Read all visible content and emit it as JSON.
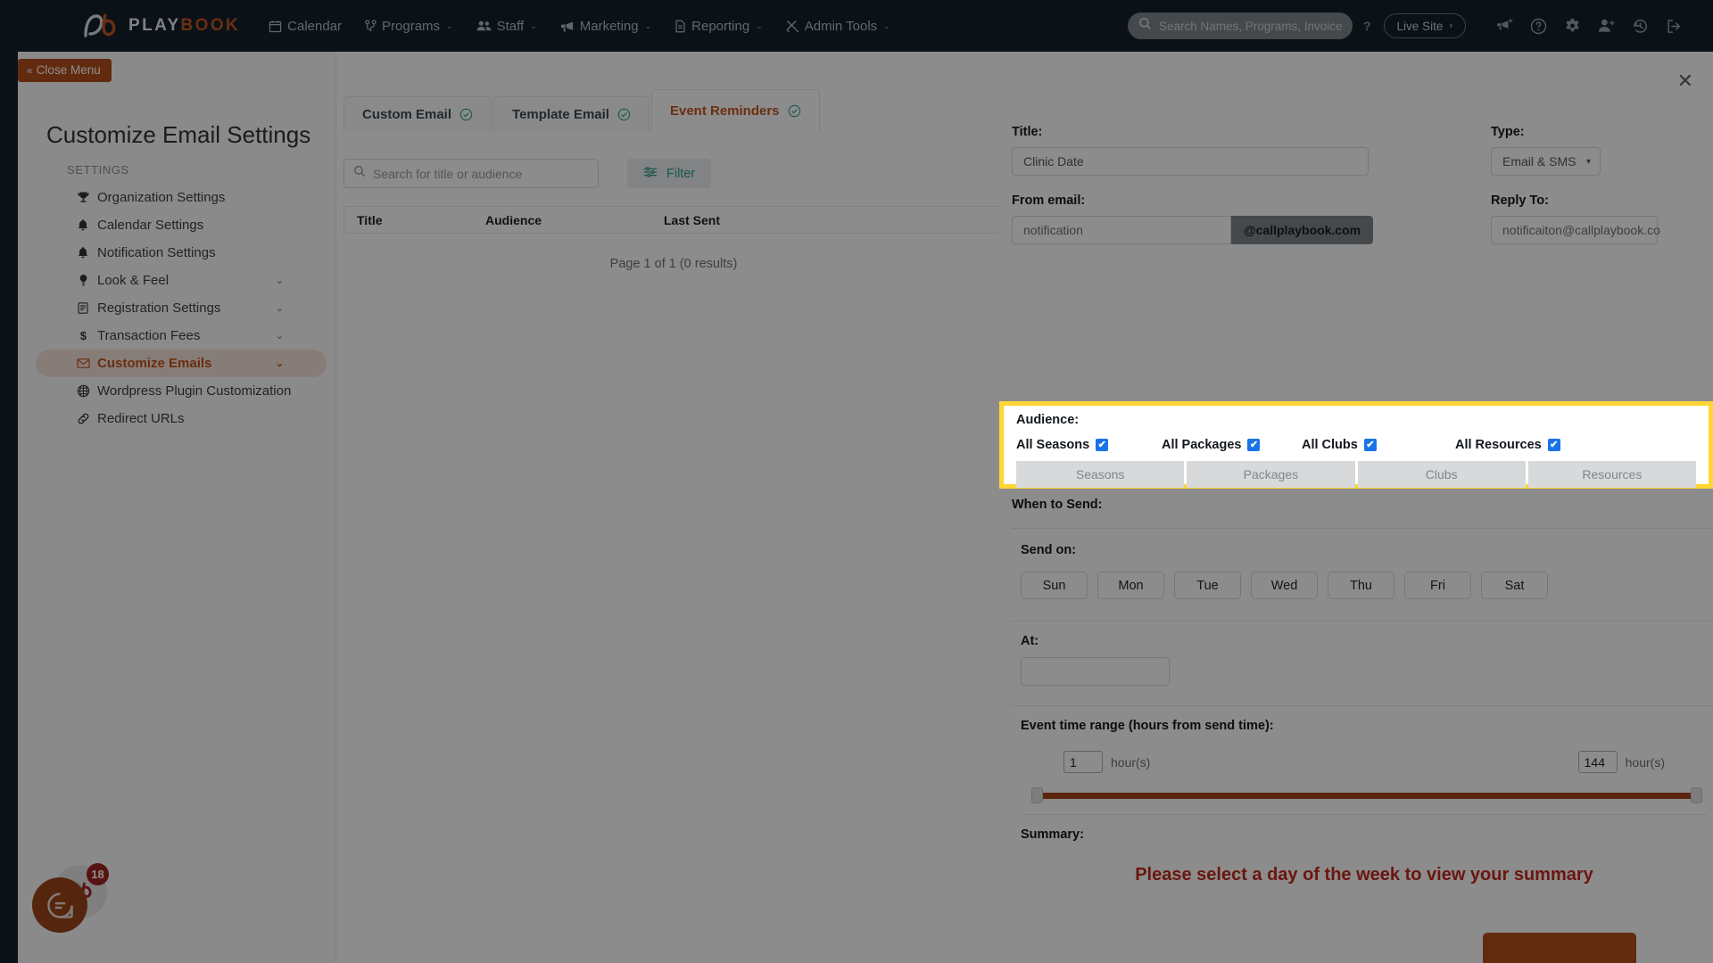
{
  "brand": {
    "name_left": "PLAY",
    "name_right": "BOOK",
    "accent": "#c4541f",
    "navbg": "#15212b"
  },
  "topnav": {
    "items": [
      {
        "label": "Calendar",
        "icon": "calendar-icon",
        "caret": false
      },
      {
        "label": "Programs",
        "icon": "sitemap-icon",
        "caret": true
      },
      {
        "label": "Staff",
        "icon": "users-icon",
        "caret": true
      },
      {
        "label": "Marketing",
        "icon": "megaphone-icon",
        "caret": true
      },
      {
        "label": "Reporting",
        "icon": "document-icon",
        "caret": true
      },
      {
        "label": "Admin Tools",
        "icon": "tools-icon",
        "caret": true
      }
    ],
    "search_placeholder": "Search Names, Programs, Invoice #...",
    "help_badge": "?",
    "live_site_label": "Live Site",
    "live_site_arrow": "›",
    "caret": "⌄",
    "right_icons": [
      "announcement-add-icon",
      "help-circle-icon",
      "gear-icon",
      "user-add-icon",
      "history-icon",
      "logout-icon"
    ]
  },
  "sidebar": {
    "close_menu_label": "Close Menu",
    "close_menu_chevron": "«",
    "title": "Customize Email Settings",
    "section_label": "SETTINGS",
    "items": [
      {
        "label": "Organization Settings",
        "icon": "trophy-icon",
        "chevron": false,
        "active": false
      },
      {
        "label": "Calendar Settings",
        "icon": "bell-icon",
        "chevron": false,
        "active": false
      },
      {
        "label": "Notification Settings",
        "icon": "bell-icon",
        "chevron": false,
        "active": false
      },
      {
        "label": "Look & Feel",
        "icon": "lightbulb-icon",
        "chevron": true,
        "active": false
      },
      {
        "label": "Registration Settings",
        "icon": "clipboard-icon",
        "chevron": true,
        "active": false
      },
      {
        "label": "Transaction Fees",
        "icon": "dollar-icon",
        "chevron": true,
        "active": false
      },
      {
        "label": "Customize Emails",
        "icon": "envelope-icon",
        "chevron": true,
        "active": true
      },
      {
        "label": "Wordpress Plugin Customization",
        "icon": "wordpress-icon",
        "chevron": false,
        "active": false
      },
      {
        "label": "Redirect URLs",
        "icon": "link-icon",
        "chevron": false,
        "active": false
      }
    ],
    "chevron_glyph": "⌄"
  },
  "tabs": [
    {
      "label": "Custom Email",
      "check": "✓",
      "active": false
    },
    {
      "label": "Template Email",
      "check": "✓",
      "active": false
    },
    {
      "label": "Event Reminders",
      "check": "✓",
      "active": true
    }
  ],
  "list_panel": {
    "search_placeholder": "Search for title or audience",
    "filter_label": "Filter",
    "columns": [
      "Title",
      "Audience",
      "Last Sent"
    ],
    "rows": [],
    "page_info": "Page 1 of 1 (0 results)"
  },
  "drawer": {
    "close_glyph": "✕",
    "title_label": "Title:",
    "title_value": "Clinic Date",
    "type_label": "Type:",
    "type_value": "Email & SMS",
    "from_email_label": "From email:",
    "from_email_value": "notification",
    "from_email_domain": "@callplaybook.com",
    "reply_to_label": "Reply To:",
    "reply_to_value": "notificaiton@callplaybook.co",
    "audience": {
      "label": "Audience:",
      "highlight_color": "#ffd633",
      "checkboxes": [
        {
          "label": "All Seasons",
          "checked": true
        },
        {
          "label": "All Packages",
          "checked": true
        },
        {
          "label": "All Clubs",
          "checked": true
        },
        {
          "label": "All Resources",
          "checked": true
        }
      ],
      "buttons": [
        "Seasons",
        "Packages",
        "Clubs",
        "Resources"
      ],
      "check_glyph": "✔"
    },
    "when_to_send_label": "When to Send:",
    "send_on_label": "Send on:",
    "days": [
      "Sun",
      "Mon",
      "Tue",
      "Wed",
      "Thu",
      "Fri",
      "Sat"
    ],
    "at_label": "At:",
    "at_value": "",
    "range_label": "Event time range (hours from send time):",
    "range_min_value": "1",
    "range_max_value": "144",
    "range_unit": "hour(s)",
    "summary_label": "Summary:",
    "summary_message": "Please select a day of the week to view your summary",
    "summary_message_color": "#c3281c"
  },
  "chat_widget": {
    "badge_count": "18",
    "icon": "chat-bubble-icon"
  }
}
